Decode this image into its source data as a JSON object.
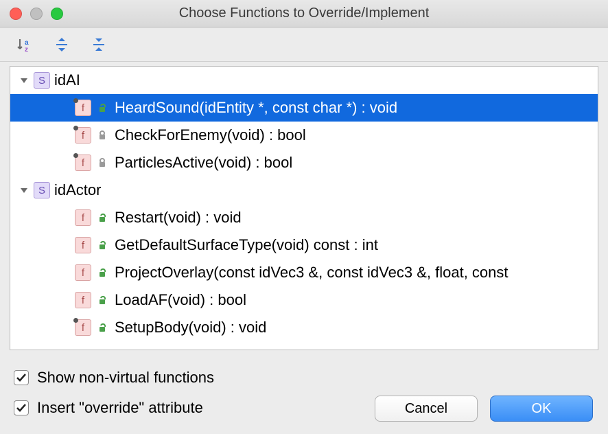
{
  "window": {
    "title": "Choose Functions to Override/Implement"
  },
  "toolbar": {
    "sort_az": "Sort alphabetically",
    "expand_all": "Expand all",
    "collapse_all": "Collapse all"
  },
  "tree": {
    "groups": [
      {
        "kind": "struct",
        "badge": "S",
        "name": "idAI",
        "items": [
          {
            "badge": "f",
            "pinned": true,
            "visibility": "public",
            "signature": "HeardSound(idEntity *, const char *) : void",
            "selected": true
          },
          {
            "badge": "f",
            "pinned": true,
            "visibility": "private",
            "signature": "CheckForEnemy(void) : bool"
          },
          {
            "badge": "f",
            "pinned": true,
            "visibility": "private",
            "signature": "ParticlesActive(void) : bool"
          }
        ]
      },
      {
        "kind": "struct",
        "badge": "S",
        "name": "idActor",
        "items": [
          {
            "badge": "f",
            "pinned": false,
            "visibility": "public",
            "signature": "Restart(void) : void"
          },
          {
            "badge": "f",
            "pinned": false,
            "visibility": "public",
            "signature": "GetDefaultSurfaceType(void) const : int"
          },
          {
            "badge": "f",
            "pinned": false,
            "visibility": "public",
            "signature": "ProjectOverlay(const idVec3 &, const idVec3 &, float, const "
          },
          {
            "badge": "f",
            "pinned": false,
            "visibility": "public",
            "signature": "LoadAF(void) : bool"
          },
          {
            "badge": "f",
            "pinned": true,
            "visibility": "public",
            "signature": "SetupBody(void) : void"
          }
        ]
      }
    ]
  },
  "options": {
    "show_non_virtual": {
      "label": "Show non-virtual functions",
      "checked": true
    },
    "insert_override": {
      "label": "Insert \"override\" attribute",
      "checked": true
    }
  },
  "buttons": {
    "cancel": "Cancel",
    "ok": "OK"
  }
}
